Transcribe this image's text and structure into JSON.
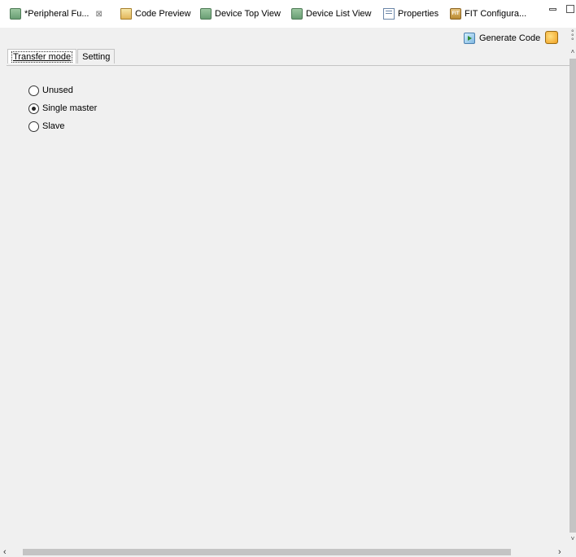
{
  "tabs": [
    {
      "label": "*Peripheral Fu...",
      "icon": "chip-icon",
      "active": true,
      "closable": true
    },
    {
      "label": "Code Preview",
      "icon": "code-preview-icon"
    },
    {
      "label": "Device Top View",
      "icon": "chip-icon"
    },
    {
      "label": "Device List View",
      "icon": "chip-icon"
    },
    {
      "label": "Properties",
      "icon": "properties-icon"
    },
    {
      "label": "FIT Configura...",
      "icon": "fit-icon"
    }
  ],
  "toolbar": {
    "generate_code_label": "Generate Code"
  },
  "subtabs": [
    {
      "label": "Transfer mode",
      "active": true
    },
    {
      "label": "Setting",
      "active": false
    }
  ],
  "transfer_mode": {
    "options": [
      {
        "label": "Unused",
        "checked": false
      },
      {
        "label": "Single master",
        "checked": true
      },
      {
        "label": "Slave",
        "checked": false
      }
    ]
  }
}
